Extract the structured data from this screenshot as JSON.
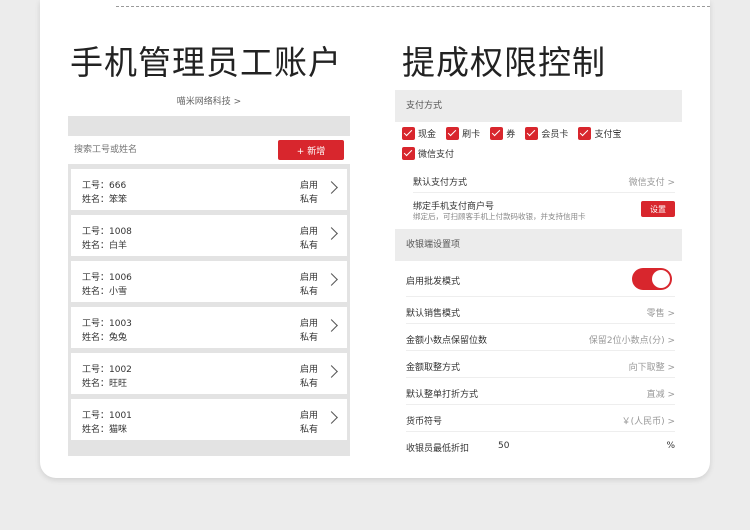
{
  "headings": {
    "left": "手机管理员工账户",
    "right": "提成权限控制"
  },
  "employees_panel": {
    "company": "喵米网络科技 >",
    "search_placeholder": "搜索工号或姓名",
    "add_label": "+ 新增",
    "rows": [
      {
        "id": "工号：666",
        "name": "姓名：笨笨",
        "status": "启用",
        "scope": "私有"
      },
      {
        "id": "工号：1008",
        "name": "姓名：白羊",
        "status": "启用",
        "scope": "私有"
      },
      {
        "id": "工号：1006",
        "name": "姓名：小雪",
        "status": "启用",
        "scope": "私有"
      },
      {
        "id": "工号：1003",
        "name": "姓名：兔兔",
        "status": "启用",
        "scope": "私有"
      },
      {
        "id": "工号：1002",
        "name": "姓名：旺旺",
        "status": "启用",
        "scope": "私有"
      },
      {
        "id": "工号：1001",
        "name": "姓名：猫咪",
        "status": "启用",
        "scope": "私有"
      }
    ]
  },
  "settings_panel": {
    "payment_header": "支付方式",
    "payment_methods": [
      "现金",
      "刷卡",
      "券",
      "会员卡",
      "支付宝",
      "微信支付"
    ],
    "default_payment": {
      "label": "默认支付方式",
      "value": "微信支付 >"
    },
    "bind_merchant": {
      "label": "绑定手机支付商户号",
      "sub": "绑定后，可扫顾客手机上付款码收银，并支持信用卡",
      "button": "设置"
    },
    "register_header": "收银端设置项",
    "batch_mode_label": "启用批发模式",
    "batch_mode_on": true,
    "options": [
      {
        "label": "默认销售模式",
        "value": "零售 >"
      },
      {
        "label": "金额小数点保留位数",
        "value": "保留2位小数点(分) >"
      },
      {
        "label": "金额取整方式",
        "value": "向下取整 >"
      },
      {
        "label": "默认整单打折方式",
        "value": "直减 >"
      },
      {
        "label": "货币符号",
        "value": "￥(人民币) >"
      }
    ],
    "min_discount": {
      "label": "收银员最低折扣",
      "value": "50",
      "unit": "%"
    }
  },
  "colors": {
    "accent": "#d8262d"
  }
}
